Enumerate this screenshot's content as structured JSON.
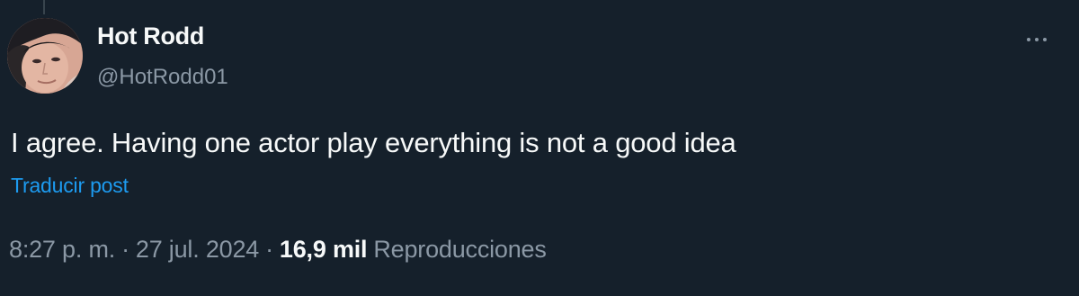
{
  "tweet": {
    "author": {
      "display_name": "Hot Rodd",
      "handle": "@HotRodd01"
    },
    "text": "I agree. Having one actor play everything is not a good idea",
    "translate_label": "Traducir post",
    "meta": {
      "time": "8:27 p. m.",
      "separator": "·",
      "date": "27 jul. 2024",
      "views_count": "16,9 mil",
      "views_label": "Reproducciones"
    },
    "more_icon": "more-horizontal-icon"
  },
  "colors": {
    "background": "#15202b",
    "primary_text": "#f7f9f9",
    "secondary_text": "#8b98a5",
    "link": "#1d9bf0"
  }
}
